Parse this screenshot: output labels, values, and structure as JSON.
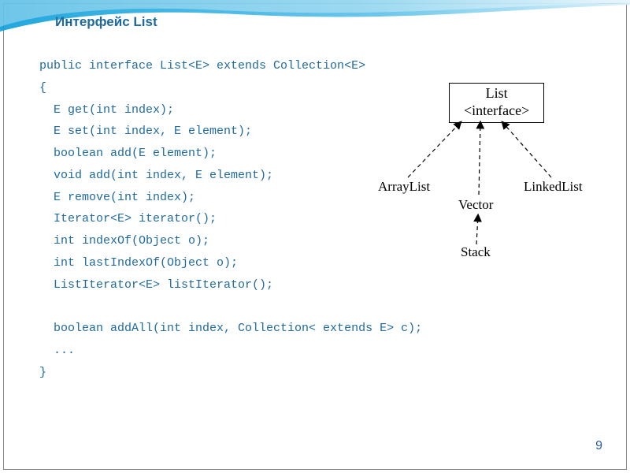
{
  "slide": {
    "title": "Интерфейс List",
    "page_number": "9"
  },
  "code": {
    "line1": "public interface List<E> extends Collection<E>",
    "line2": "{",
    "line3": "  E get(int index);",
    "line4": "  E set(int index, E element);",
    "line5": "  boolean add(E element);",
    "line6": "  void add(int index, E element);",
    "line7": "  E remove(int index);",
    "line8": "  Iterator<E> iterator();",
    "line9": "  int indexOf(Object o);",
    "line10": "  int lastIndexOf(Object o);",
    "line11": "  ListIterator<E> listIterator();",
    "line12": "",
    "line13": "  boolean addAll(int index, Collection< extends E> c);",
    "line14": "  ...",
    "line15": "}"
  },
  "diagram": {
    "root_title": "List",
    "root_subtitle": "<interface>",
    "arraylist": "ArrayList",
    "vector": "Vector",
    "linkedlist": "LinkedList",
    "stack": "Stack"
  }
}
